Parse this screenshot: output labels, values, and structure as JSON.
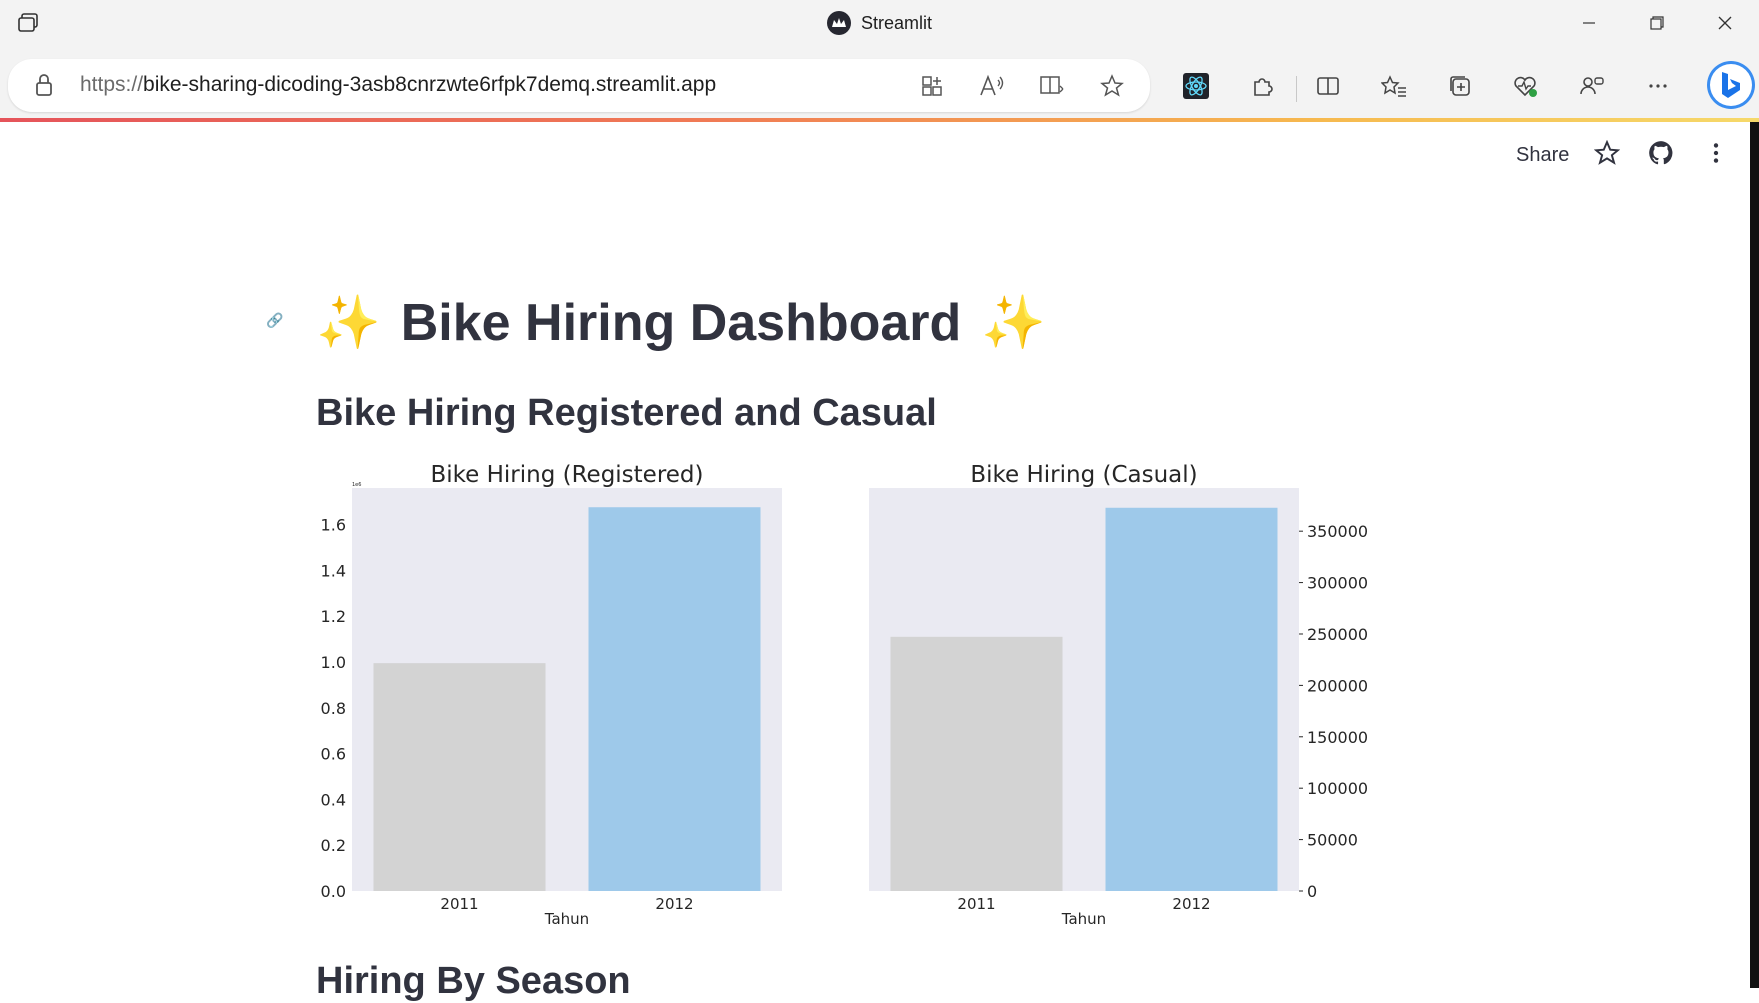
{
  "browser": {
    "window_title": "Streamlit",
    "url_protocol": "https://",
    "url_host": "bike-sharing-dicoding-3asb8cnrzwte6rfpk7demq.streamlit.app",
    "accent_loading": "#e5545a"
  },
  "app_header": {
    "share_label": "Share"
  },
  "page": {
    "title_emoji_left": "✨",
    "title": "Bike Hiring Dashboard",
    "title_emoji_right": "✨",
    "section1_title": "Bike Hiring Registered and Casual",
    "section2_title": "Hiring By Season"
  },
  "chart_data": [
    {
      "type": "bar",
      "title": "Bike Hiring (Registered)",
      "xlabel": "Tahun",
      "ylabel": "",
      "categories": [
        "2011",
        "2012"
      ],
      "values": [
        0.995,
        1.676
      ],
      "scale_label": "1e6",
      "ylim": [
        0,
        1.76
      ],
      "yticks": [
        "0.0",
        "0.2",
        "0.4",
        "0.6",
        "0.8",
        "1.0",
        "1.2",
        "1.4",
        "1.6"
      ],
      "bar_colors": [
        "#d3d3d3",
        "#9ec9ea"
      ],
      "y_axis_side": "left",
      "grid": false
    },
    {
      "type": "bar",
      "title": "Bike Hiring (Casual)",
      "xlabel": "Tahun",
      "ylabel": "",
      "categories": [
        "2011",
        "2012"
      ],
      "values": [
        247252,
        372765
      ],
      "ylim": [
        0,
        392000
      ],
      "yticks": [
        "0",
        "50000",
        "100000",
        "150000",
        "200000",
        "250000",
        "300000",
        "350000"
      ],
      "bar_colors": [
        "#d3d3d3",
        "#9ec9ea"
      ],
      "y_axis_side": "right",
      "grid": false
    }
  ]
}
